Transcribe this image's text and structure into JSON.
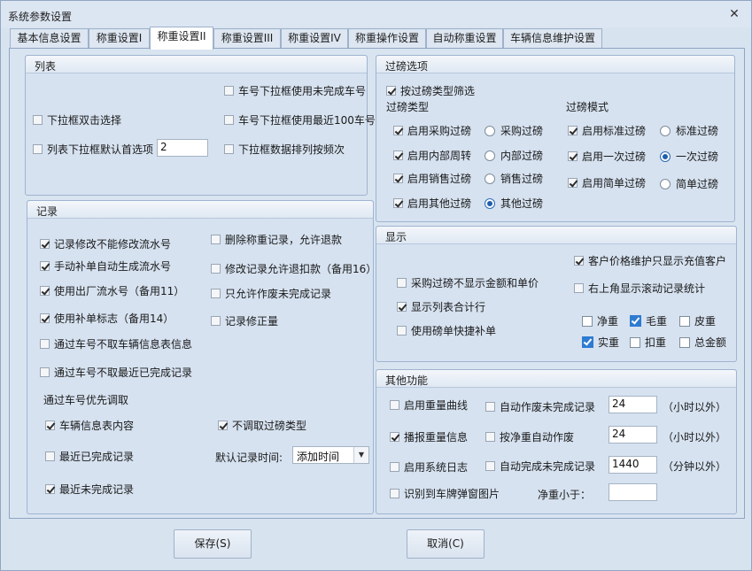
{
  "window": {
    "title": "系统参数设置",
    "close_icon": "close-icon"
  },
  "tabs": [
    "基本信息设置",
    "称重设置I",
    "称重设置II",
    "称重设置III",
    "称重设置IV",
    "称重操作设置",
    "自动称重设置",
    "车辆信息维护设置"
  ],
  "list_group": {
    "title": "列表",
    "dropdown_doubleclick": "下拉框双击选择",
    "dropdown_default_first": "列表下拉框默认首选项",
    "dropdown_default_value": "2",
    "plate_unfinished": "车号下拉框使用未完成车号",
    "plate_recent100": "车号下拉框使用最近100车号",
    "dropdown_sort_freq": "下拉框数据排列按频次"
  },
  "record_group": {
    "title": "记录",
    "no_modify_serial": "记录修改不能修改流水号",
    "manual_auto_serial": "手动补单自动生成流水号",
    "use_outbound_serial": "使用出厂流水号（备用11）",
    "use_supplement_flag": "使用补单标志（备用14）",
    "no_vehicle_info": "通过车号不取车辆信息表信息",
    "no_recent_complete": "通过车号不取最近已完成记录",
    "delete_allow_refund": "删除称重记录，允许退款",
    "modify_allow_refund": "修改记录允许退扣款（备用16）",
    "only_void_unfinished": "只允许作废未完成记录",
    "record_correction": "记录修正量",
    "priority_title": "通过车号优先调取",
    "vehicle_info_content": "车辆信息表内容",
    "recent_completed": "最近已完成记录",
    "recent_unfinished": "最近未完成记录",
    "no_filter_type": "不调取过磅类型",
    "default_time_label": "默认记录时间:",
    "default_time_value": "添加时间"
  },
  "filter_group": {
    "title": "过磅选项",
    "filter_by_type": "按过磅类型筛选",
    "type_title": "过磅类型",
    "mode_title": "过磅模式",
    "type_enable": [
      "启用采购过磅",
      "启用内部周转",
      "启用销售过磅",
      "启用其他过磅"
    ],
    "type_radio": [
      "采购过磅",
      "内部过磅",
      "销售过磅",
      "其他过磅"
    ],
    "mode_enable": [
      "启用标准过磅",
      "启用一次过磅",
      "启用简单过磅"
    ],
    "mode_radio": [
      "标准过磅",
      "一次过磅",
      "简单过磅"
    ]
  },
  "display_group": {
    "title": "显示",
    "purchase_hide_amount": "采购过磅不显示金额和单价",
    "show_list_total": "显示列表合计行",
    "use_ticket_quick": "使用磅单快捷补单",
    "customer_price_show": "客户价格维护只显示充值客户",
    "scroll_record_stats": "右上角显示滚动记录统计",
    "net_weight": "净重",
    "gross_weight": "毛重",
    "tare_weight": "皮重",
    "actual_weight": "实重",
    "deduct_weight": "扣重",
    "total_amount": "总金额"
  },
  "other_group": {
    "title": "其他功能",
    "enable_weight_curve": "启用重量曲线",
    "broadcast_weight": "播报重量信息",
    "enable_system_log": "启用系统日志",
    "recognize_plate_popup": "识别到车牌弹窗图片",
    "auto_void_unfinished": "自动作废未完成记录",
    "auto_void_value": "24",
    "auto_void_unit": "（小时以外）",
    "net_auto_void": "按净重自动作废",
    "net_auto_void_value": "24",
    "net_auto_void_unit": "（小时以外）",
    "auto_complete_unfinished": "自动完成未完成记录",
    "auto_complete_value": "1440",
    "auto_complete_unit": "（分钟以外）",
    "net_less_than": "净重小于：",
    "net_less_than_value": ""
  },
  "buttons": {
    "save": "保存(S)",
    "cancel": "取消(C)"
  }
}
